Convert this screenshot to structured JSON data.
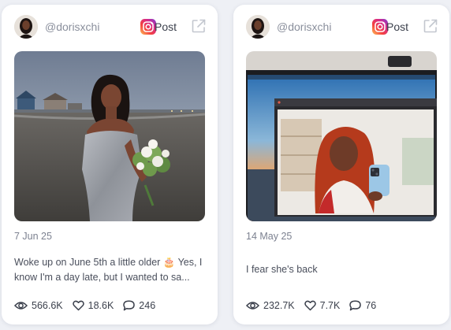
{
  "posts": [
    {
      "username": "@dorisxchi",
      "platform_icon": "instagram-icon",
      "post_label": "Post",
      "external_icon": "external-link-icon",
      "date": "7 Jun 25",
      "caption": "Woke up on June 5th a little older 🎂 Yes, I know I'm a day late, but I wanted to sa...",
      "views": "566.6K",
      "likes": "18.6K",
      "comments": "246"
    },
    {
      "username": "@dorisxchi",
      "platform_icon": "instagram-icon",
      "post_label": "Post",
      "external_icon": "external-link-icon",
      "date": "14 May 25",
      "caption": "I fear she's back",
      "views": "232.7K",
      "likes": "7.7K",
      "comments": "76"
    }
  ],
  "colors": {
    "page_bg": "#eef0f5",
    "card_bg": "#ffffff",
    "muted_text": "#8a8f9c",
    "body_text": "#4a4f5c"
  }
}
